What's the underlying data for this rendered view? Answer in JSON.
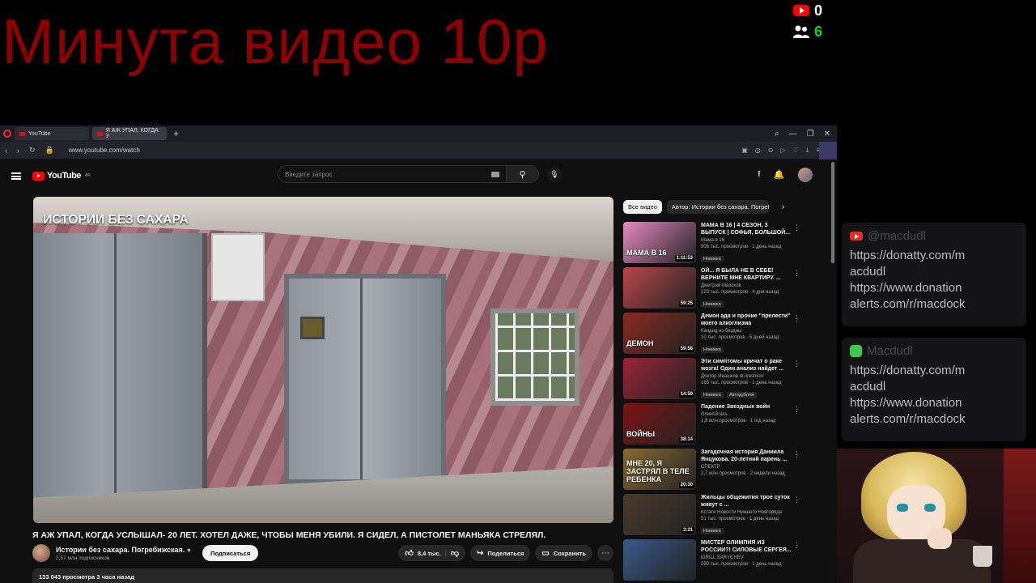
{
  "overlay": {
    "title": "Минута видео 10р",
    "youtube_count": "0",
    "viewers_count": "6"
  },
  "browser": {
    "tabs": [
      {
        "label": "YouTube"
      },
      {
        "label": "Я АЖ УПАЛ, КОГДА У"
      }
    ],
    "url": "www.youtube.com/watch"
  },
  "youtube": {
    "logo_text": "YouTube",
    "logo_region": "AR",
    "search_placeholder": "Введите запрос",
    "player_logo": "ИСТОРИИ БЕЗ САХАРА",
    "video_title": "Я АЖ УПАЛ, КОГДА УСЛЫШАЛ- 20 ЛЕТ. ХОТЕЛ ДАЖЕ, ЧТОБЫ МЕНЯ УБИЛИ. Я СИДЕЛ, А ПИСТОЛЕТ МАНЬЯКА СТРЕЛЯЛ.",
    "channel_name": "Истории без сахара. Погребижская.",
    "channel_subs": "2,57 млн подписчиков",
    "subscribe_label": "Подписаться",
    "likes": "8,4 тыс.",
    "share_label": "Поделиться",
    "save_label": "Сохранить",
    "description_meta": "133 043 просмотра  3 часа назад",
    "chips": [
      "Все видео",
      "Автор: Истории без сахара. Погребижская."
    ]
  },
  "recommendations": [
    {
      "title": "МАМА В 16 | 4 СЕЗОН, 3 ВЫПУСК | СОФЬЯ, БОЛЬШОЙ...",
      "channel": "Мама в 16",
      "meta": "906 тыс. просмотров · 1 день назад",
      "badge": "Новинка",
      "duration": "1:11:53",
      "thumb_text": "МАМА В 16",
      "color": "#e58ac0"
    },
    {
      "title": "ОЙ... Я БЫЛА НЕ В СЕБЕ! ВЕРНИТЕ МНЕ КВАРТИРУ. ...",
      "channel": "Дмитрий Мазохов",
      "meta": "223 тыс. просмотров · 4 дня назад",
      "badge": "Новинка",
      "duration": "59:25",
      "thumb_text": "",
      "color": "#b9464a"
    },
    {
      "title": "Демон ада и прочие \"прелести\" моего алкоглизма",
      "channel": "Кандид из бездны",
      "meta": "10 тыс. просмотров · 5 дней назад",
      "badge": "Новинка",
      "duration": "59:58",
      "thumb_text": "ДЕМОН",
      "color": "#8a2a20"
    },
    {
      "title": "Эти симптомы кричат о раке мозга! Один анализ найдет ...",
      "channel": "Доктор Ивашков dr.ivashkov",
      "meta": "165 тыс. просмотров · 1 день назад",
      "badge": "Новинка",
      "badge2": "Автодубляж",
      "duration": "14:59",
      "thumb_text": "",
      "color": "#9a2436"
    },
    {
      "title": "Падение Звездных войн",
      "channel": "GreenGrass",
      "meta": "1,8 млн просмотров · 1 год назад",
      "badge": "",
      "duration": "38:14",
      "thumb_text": "ВОЙНЫ",
      "color": "#7a1414"
    },
    {
      "title": "Загадочная история Даниила Янцукова. 20-летний парень ...",
      "channel": "СПЕКТР",
      "meta": "2,7 млн просмотров · 2 недели назад",
      "badge": "",
      "duration": "20:30",
      "thumb_text": "МНЕ 20, Я ЗАСТРЯЛ В ТЕЛЕ РЕБЕНКА",
      "color": "#8a6a30"
    },
    {
      "title": "Жильцы общежития трое суток живут с ...",
      "channel": "Кстати Новости Нижнего Новгорода",
      "meta": "51 тыс. просмотров · 1 день назад",
      "badge": "Новинка",
      "duration": "3:21",
      "thumb_text": "",
      "color": "#4a3a2c"
    },
    {
      "title": "МИСТЕР ОЛИМПИЯ ИЗ РОССИИ?! СИЛОВЫЕ СЕРГЕЯ...",
      "channel": "KIRILL SARYCHEV",
      "meta": "290 тыс. просмотров · 1 день назад",
      "badge": "",
      "duration": "",
      "thumb_text": "",
      "color": "#3a5a8a"
    }
  ],
  "panels": [
    {
      "name": "@macdudl",
      "text": "https://donatty.com/macdudl https://www.donationalerts.com/r/macdock",
      "icon": "youtube-icon"
    },
    {
      "name": "Macdudl",
      "text": "https://donatty.com/macdudl https://www.donationalerts.com/r/macdock",
      "icon": "green-app-icon"
    }
  ]
}
